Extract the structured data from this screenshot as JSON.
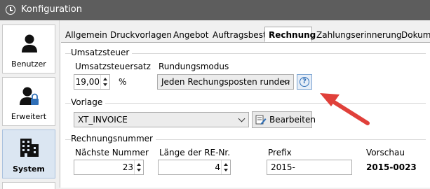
{
  "window": {
    "title": "Konfiguration"
  },
  "sidebar": {
    "items": [
      {
        "label": "Benutzer",
        "icon": "user-icon"
      },
      {
        "label": "Erweitert",
        "icon": "user-lock-icon"
      },
      {
        "label": "System",
        "icon": "building-icon",
        "active": true
      }
    ]
  },
  "tabs": [
    "Allgemein",
    "Druckvorlagen",
    "Angebot",
    "Auftragsbest.",
    "Rechnung",
    "Zahlungserinnerung",
    "Dokume"
  ],
  "umsatzsteuer": {
    "title": "Umsatzsteuer",
    "rate_label": "Umsatzsteuersatz",
    "rate_value": "19,00",
    "percent": "%",
    "rounding_label": "Rundungsmodus",
    "rounding_value": "Jeden Rechungsposten runden"
  },
  "vorlage": {
    "title": "Vorlage",
    "template_value": "XT_INVOICE",
    "edit_label": "Bearbeiten"
  },
  "rechnungsnummer": {
    "title": "Rechnungsnummer",
    "next_label": "Nächste Nummer",
    "next_value": "23",
    "length_label": "Länge der RE-Nr.",
    "length_value": "4",
    "prefix_label": "Prefix",
    "prefix_value": "2015-",
    "preview_label": "Vorschau",
    "preview_value": "2015-0023"
  },
  "colors": {
    "titlebar": "#5d5d5d",
    "arrow": "#e0403a",
    "help": "#2f6fb7"
  }
}
